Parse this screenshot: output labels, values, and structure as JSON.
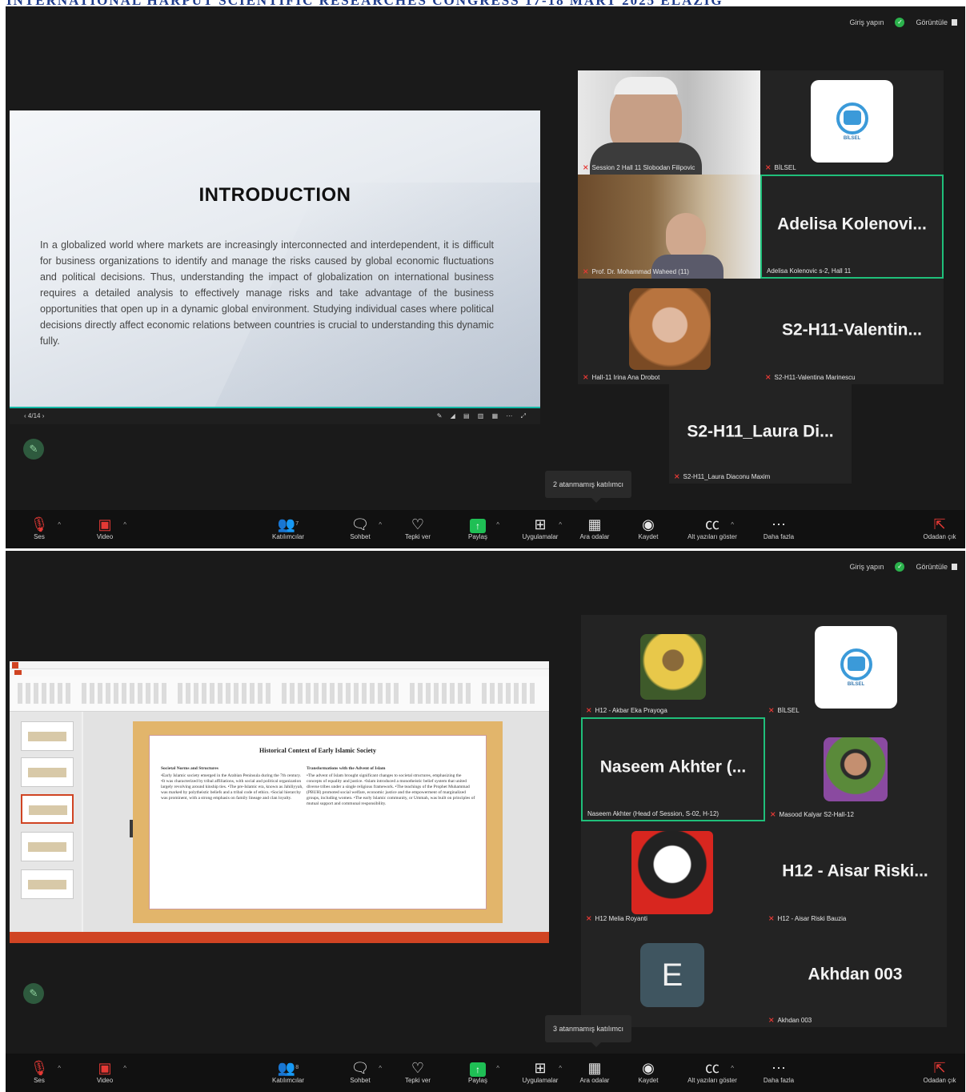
{
  "banner": {
    "text": "INTERNATIONAL HARPUT SCIENTIFIC RESEARCHES CONGRESS 17-18 MART 2025 ELAZIG"
  },
  "screens": [
    {
      "topbar": {
        "enter": "Giriş yapın",
        "view": "Görüntüle"
      },
      "slide": {
        "heading": "INTRODUCTION",
        "body": "In a globalized world where markets are increasingly interconnected and interdependent, it is difficult for business organizations to identify and manage the risks caused by global economic fluctuations and political decisions. Thus, understanding the impact of globalization on international business requires a detailed analysis to effectively manage risks and take advantage of the business opportunities that open up in a dynamic global environment. Studying individual cases where political decisions directly affect economic relations between countries is crucial to understanding this dynamic fully.",
        "counter": "4/14"
      },
      "participants": [
        {
          "label": "Session 2 Hall 11 Slobodan Filipovic",
          "display_name": ""
        },
        {
          "label": "BİLSEL",
          "display_name": ""
        },
        {
          "label": "Prof. Dr. Mohammad Waheed (11)",
          "display_name": ""
        },
        {
          "label": "Adelisa Kolenovic s-2, Hall 11",
          "display_name": "Adelisa Kolenovi..."
        },
        {
          "label": "Hall-11 Irina Ana Drobot",
          "display_name": ""
        },
        {
          "label": "S2-H11-Valentina Marinescu",
          "display_name": "S2-H11-Valentin..."
        },
        {
          "label": "S2-H11_Laura Diaconu Maxim",
          "display_name": "S2-H11_Laura Di..."
        }
      ],
      "tooltip": "2 atanmamış katılımcı"
    },
    {
      "topbar": {
        "enter": "Giriş yapın",
        "view": "Görüntüle"
      },
      "slide": {
        "heading": "Historical Context of Early Islamic Society",
        "col1_title": "Societal Norms and Structures",
        "col1_body": "•Early Islamic society emerged in the Arabian Peninsula during the 7th century. •It was characterized by tribal affiliations, with social and political organization largely revolving around kinship ties. •The pre-Islamic era, known as Jahiliyyah, was marked by polytheistic beliefs and a tribal code of ethics. •Social hierarchy was prominent, with a strong emphasis on family lineage and clan loyalty.",
        "col2_title": "Transformations with the Advent of Islam",
        "col2_body": "•The advent of Islam brought significant changes to societal structures, emphasizing the concepts of equality and justice. •Islam introduced a monotheistic belief system that united diverse tribes under a single religious framework. •The teachings of the Prophet Muhammad (PBUH) promoted social welfare, economic justice and the empowerment of marginalized groups, including women. •The early Islamic community, or Ummah, was built on principles of mutual support and communal responsibility."
      },
      "participants": [
        {
          "label": "H12 - Akbar Eka Prayoga",
          "display_name": ""
        },
        {
          "label": "BİLSEL",
          "display_name": ""
        },
        {
          "label": "Naseem Akhter (Head of Session, S-02, H-12)",
          "display_name": "Naseem Akhter (..."
        },
        {
          "label": "Masood Kalyar S2-Hall-12",
          "display_name": ""
        },
        {
          "label": "H12 Melia Royanti",
          "display_name": ""
        },
        {
          "label": "H12 - Aisar Riski Bauzia",
          "display_name": "H12 - Aisar Riski..."
        },
        {
          "label": "",
          "display_name": "",
          "avatar_letter": "E"
        },
        {
          "label": "Akhdan 003",
          "display_name": "Akhdan 003"
        }
      ],
      "tooltip": "3 atanmamış katılımcı"
    }
  ],
  "toolbar": {
    "audio": "Ses",
    "video": "Video",
    "participants": "Katılımcılar",
    "participants_count_1": "7",
    "participants_count_2": "8",
    "chat": "Sohbet",
    "react": "Tepki ver",
    "share": "Paylaş",
    "apps": "Uygulamalar",
    "breakout": "Ara odalar",
    "record": "Kaydet",
    "captions": "Alt yazıları göster",
    "more": "Daha fazla",
    "leave": "Odadan çık"
  },
  "colors": {
    "active_border": "#1fbf7a",
    "share_green": "#1fbf55",
    "mute_red": "#e53935",
    "banner_blue": "#1f3c8c"
  },
  "icons": [
    "microphone-muted-icon",
    "video-off-icon",
    "participants-icon",
    "chat-icon",
    "heart-icon",
    "share-screen-icon",
    "apps-icon",
    "breakout-rooms-icon",
    "record-icon",
    "captions-icon",
    "more-icon",
    "leave-icon",
    "annotate-pen-icon",
    "shield-check-icon",
    "view-icon"
  ]
}
